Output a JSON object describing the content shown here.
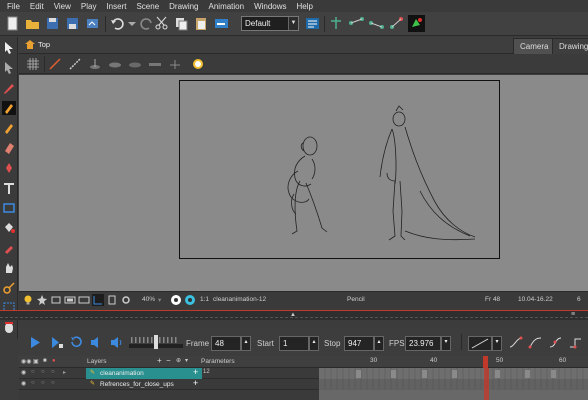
{
  "menu": [
    "File",
    "Edit",
    "View",
    "Play",
    "Insert",
    "Scene",
    "Drawing",
    "Animation",
    "Windows",
    "Help"
  ],
  "toolbar": {
    "preset_value": "Default"
  },
  "view": {
    "title": "Top",
    "tabs": [
      "Camera",
      "Drawing"
    ]
  },
  "status": {
    "zoom": "40%",
    "ratio": "1:1",
    "drawing_name": "cleananimation-12",
    "tool": "Pencil",
    "frame": "Fr 48",
    "coords": "10.04-16.22",
    "extra": "6"
  },
  "playback": {
    "frame_label": "Frame",
    "frame_value": "48",
    "start_label": "Start",
    "start_value": "1",
    "stop_label": "Stop",
    "stop_value": "947",
    "fps_label": "FPS",
    "fps_value": "23.976"
  },
  "timeline": {
    "layers_label": "Layers",
    "parameters_label": "Parameters",
    "ruler": [
      "30",
      "40",
      "50",
      "60"
    ],
    "current_frame_marker": "48",
    "rows": [
      {
        "name": "cleananimation",
        "value": "12",
        "selected": true
      },
      {
        "name": "Refrences_for_close_ups",
        "value": "",
        "selected": false
      }
    ]
  },
  "colors": {
    "accent_teal": "#2a8f8f",
    "playhead_red": "#c0392b",
    "canvas_bg": "#8a8a8a"
  }
}
